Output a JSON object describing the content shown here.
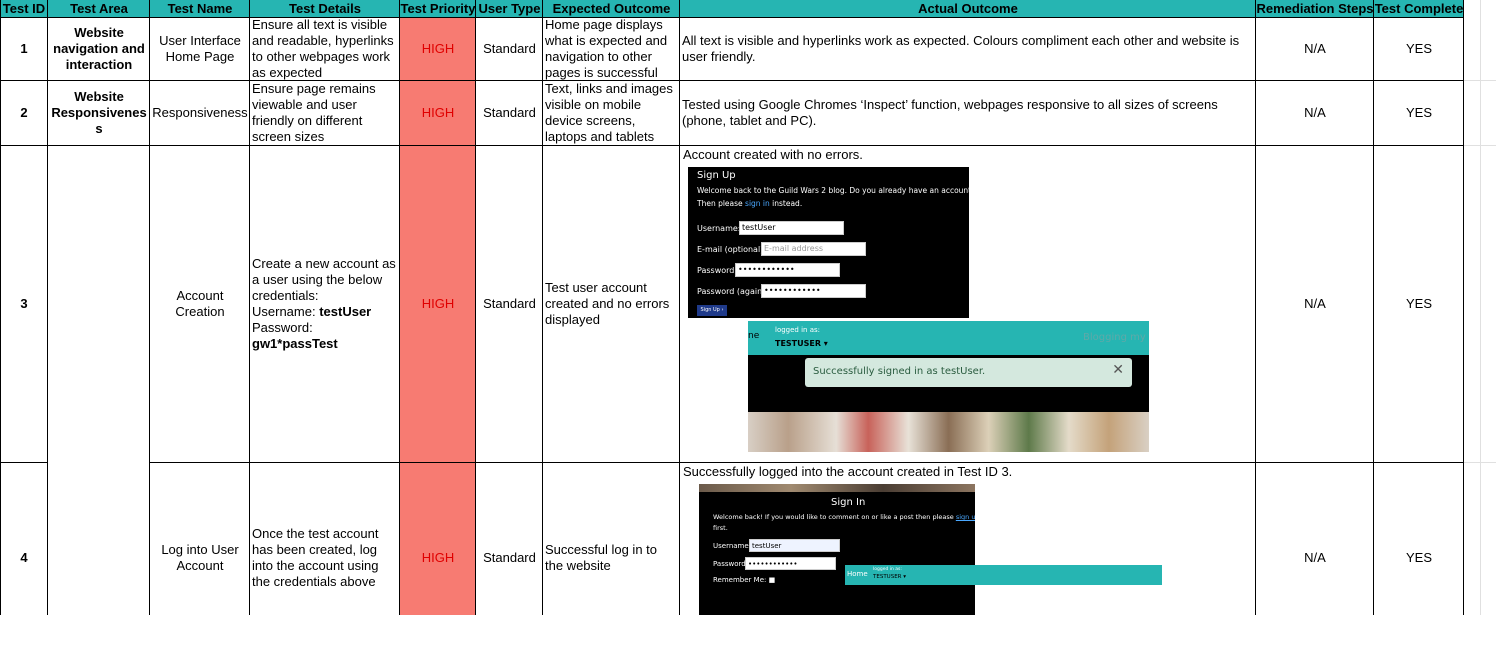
{
  "headers": [
    "Test ID",
    "Test Area",
    "Test Name",
    "Test Details",
    "Test Priority",
    "User Type",
    "Expected Outcome",
    "Actual Outcome",
    "Remediation Steps",
    "Test Complete"
  ],
  "rows": [
    {
      "id": "1",
      "area_lines": [
        "Website",
        "navigation and",
        "interaction"
      ],
      "name_lines": [
        "User Interface",
        "Home Page"
      ],
      "details_lines": [
        "Ensure all text is visible",
        "and readable, hyperlinks",
        "to other webpages work",
        "as expected"
      ],
      "priority": "HIGH",
      "user_type": "Standard",
      "expected_lines": [
        "Home page displays",
        "what is expected and",
        "navigation to other",
        "pages is successful"
      ],
      "actual_lines": [
        "All text is visible and hyperlinks work as expected. Colours compliment each other and website is",
        "user friendly."
      ],
      "remediation": "N/A",
      "complete": "YES"
    },
    {
      "id": "2",
      "area_lines": [
        "Website",
        "Responsivenes",
        "s"
      ],
      "name_lines": [
        "Responsiveness"
      ],
      "details_lines": [
        "Ensure page remains",
        "viewable and user",
        "friendly on different",
        "screen sizes"
      ],
      "priority": "HIGH",
      "user_type": "Standard",
      "expected_lines": [
        "Text, links and images",
        "visible on mobile",
        "device screens,",
        "laptops and tablets"
      ],
      "actual_lines": [
        "Tested using Google Chromes ‘Inspect’ function, webpages responsive to all sizes of screens",
        "(phone, tablet and PC)."
      ],
      "remediation": "N/A",
      "complete": "YES"
    },
    {
      "id": "3",
      "name_lines": [
        "Account",
        "Creation"
      ],
      "details_lines": [
        "Create a new account as",
        "a user using the below",
        "credentials:"
      ],
      "details_username_label": "Username: ",
      "details_username_value": "testUser",
      "details_password_label": "Password:",
      "details_password_value": "gw1*passTest",
      "priority": "HIGH",
      "user_type": "Standard",
      "expected_lines": [
        "Test user account",
        "created and no errors",
        "displayed"
      ],
      "actual_caption": "Account created with no errors.",
      "signup": {
        "title": "Sign Up",
        "welcome": "Welcome back to the Guild Wars 2 blog. Do you already have an account?",
        "then_please": "Then please ",
        "sign_in_link": "sign in",
        "instead": " instead.",
        "username_label": "Username:",
        "username_value": "testUser",
        "email_label": "E-mail (optional):",
        "email_placeholder": "E-mail address",
        "password_label": "Password:",
        "password_value": "••••••••••••",
        "password_again_label": "Password (again):",
        "password_again_value": "••••••••••••",
        "button": "Sign Up ›"
      },
      "signed_in": {
        "home_fragment": "ne",
        "logged_in_as": "logged in as:",
        "user": "TESTUSER ▾",
        "brand_fragment": "Blogging my G",
        "message": "Successfully signed in as testUser.",
        "close": "✕"
      },
      "remediation": "N/A",
      "complete": "YES"
    },
    {
      "id": "4",
      "name_lines": [
        "Log into User",
        "Account"
      ],
      "details_lines": [
        "Once the test account",
        "has been created, log",
        "into the account using",
        "the credentials above"
      ],
      "priority": "HIGH",
      "user_type": "Standard",
      "expected_lines": [
        "Successful log in to",
        "the website"
      ],
      "actual_caption": "Successfully logged into the account created in Test ID 3.",
      "signin": {
        "title": "Sign In",
        "welcome": "Welcome back! If you would like to comment on or like a post then please ",
        "sign_up_link": "sign up",
        "first": "first.",
        "username_label": "Username:",
        "username_value": "testUser",
        "password_label": "Password:",
        "password_value": "••••••••••••",
        "remember": "Remember Me: ■"
      },
      "nav": {
        "home": "Home",
        "logged_in_as": "logged in as:",
        "user": "TESTUSER ▾"
      },
      "remediation": "N/A",
      "complete": "YES"
    }
  ],
  "colors": {
    "header": "#26b5b2",
    "priority": "#f77b72",
    "priority_text": "#e00000",
    "teal": "#26b5b2"
  }
}
